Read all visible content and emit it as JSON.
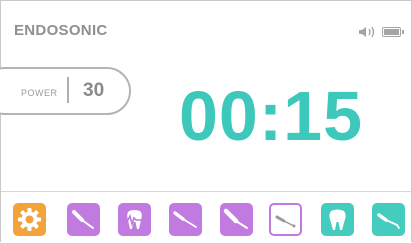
{
  "header": {
    "title": "ENDOSONIC",
    "speaker_icon": "speaker-volume-icon",
    "battery_icon": "battery-icon"
  },
  "power": {
    "label": "POWER",
    "value": "30"
  },
  "timer": {
    "value": "00:15"
  },
  "toolbar": {
    "buttons": [
      {
        "name": "settings",
        "icon": "gear-icon",
        "color": "#f2a33a"
      },
      {
        "name": "endo-tip-1",
        "icon": "instrument-tip-icon",
        "color": "#c07ae0"
      },
      {
        "name": "tooth-pulse",
        "icon": "tooth-pulse-icon",
        "color": "#c07ae0"
      },
      {
        "name": "endo-tip-2",
        "icon": "instrument-tip-icon",
        "color": "#c07ae0"
      },
      {
        "name": "endo-tip-3",
        "icon": "instrument-tip-icon",
        "color": "#c07ae0"
      },
      {
        "name": "endo-tip-selected",
        "icon": "instrument-tip-icon",
        "color": "#c07ae0",
        "selected": true
      },
      {
        "name": "tooth",
        "icon": "tooth-icon",
        "color": "#44ccbf"
      },
      {
        "name": "scaler-tip",
        "icon": "instrument-tip-icon",
        "color": "#44ccbf"
      }
    ]
  },
  "colors": {
    "accent": "#3dc8bb",
    "purple": "#c07ae0",
    "orange": "#f2a33a",
    "gray_text": "#8f8f8f"
  }
}
